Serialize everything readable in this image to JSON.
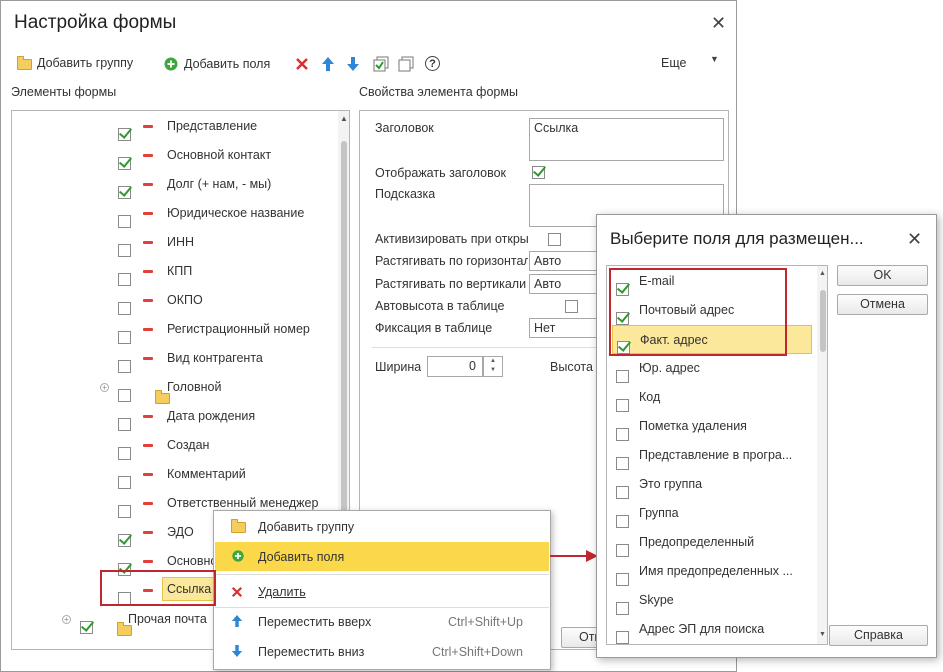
{
  "main_dialog": {
    "title": "Настройка формы",
    "toolbar": {
      "add_group": "Добавить группу",
      "add_fields": "Добавить поля",
      "more": "Еще",
      "help": "?"
    },
    "left_panel_title": "Элементы формы",
    "right_panel_title": "Свойства элемента формы",
    "tree_items": [
      {
        "label": "Представление",
        "checked": true
      },
      {
        "label": "Основной контакт",
        "checked": true
      },
      {
        "label": "Долг (+ нам, - мы)",
        "checked": true
      },
      {
        "label": "Юридическое название",
        "checked": false
      },
      {
        "label": "ИНН",
        "checked": false
      },
      {
        "label": "КПП",
        "checked": false
      },
      {
        "label": "ОКПО",
        "checked": false
      },
      {
        "label": "Регистрационный номер",
        "checked": false
      },
      {
        "label": "Вид контрагента",
        "checked": false
      },
      {
        "label": "Головной",
        "checked": false,
        "folder": true
      },
      {
        "label": "Дата рождения",
        "checked": false
      },
      {
        "label": "Создан",
        "checked": false
      },
      {
        "label": "Комментарий",
        "checked": false
      },
      {
        "label": "Ответственный менеджер",
        "checked": false
      },
      {
        "label": "ЭДО",
        "checked": true
      },
      {
        "label": "Основной",
        "checked": true
      },
      {
        "label": "Ссылка",
        "checked": false,
        "selected": true
      }
    ],
    "tree_partial_item": "Прочая почта",
    "properties": {
      "header_label": "Заголовок",
      "header_value": "Ссылка",
      "show_header_label": "Отображать заголовок",
      "hint_label": "Подсказка",
      "activate_label": "Активизировать при открытии",
      "stretch_h_label": "Растягивать по горизонтали",
      "stretch_h_value": "Авто",
      "stretch_v_label": "Растягивать по вертикали",
      "stretch_v_value": "Авто",
      "autoheight_label": "Автовысота в таблице",
      "fix_label": "Фиксация в таблице",
      "fix_value": "Нет",
      "width_label": "Ширина",
      "width_value": "0",
      "height_label": "Высота"
    },
    "bottom_button_partial": "Отм"
  },
  "context_menu": {
    "items": [
      {
        "label": "Добавить группу",
        "shortcut": ""
      },
      {
        "label": "Добавить поля",
        "shortcut": "",
        "highlighted": true
      },
      {
        "label": "Удалить",
        "shortcut": ""
      },
      {
        "label": "Переместить вверх",
        "shortcut": "Ctrl+Shift+Up"
      },
      {
        "label": "Переместить вниз",
        "shortcut": "Ctrl+Shift+Down"
      }
    ]
  },
  "picker_dialog": {
    "title": "Выберите поля для размещен...",
    "ok": "OK",
    "cancel": "Отмена",
    "help": "Справка",
    "fields": [
      {
        "label": "E-mail",
        "checked": true
      },
      {
        "label": "Почтовый адрес",
        "checked": true
      },
      {
        "label": "Факт. адрес",
        "checked": true,
        "highlighted": true
      },
      {
        "label": "Юр. адрес",
        "checked": false
      },
      {
        "label": "Код",
        "checked": false
      },
      {
        "label": "Пометка удаления",
        "checked": false
      },
      {
        "label": "Представление в програ...",
        "checked": false
      },
      {
        "label": "Это группа",
        "checked": false
      },
      {
        "label": "Группа",
        "checked": false
      },
      {
        "label": "Предопределенный",
        "checked": false
      },
      {
        "label": "Имя предопределенных ...",
        "checked": false
      },
      {
        "label": "Skype",
        "checked": false
      },
      {
        "label": "Адрес ЭП для поиска",
        "checked": false
      }
    ]
  },
  "colors": {
    "highlight": "#fbd84a",
    "annotation_red": "#c0262d",
    "check_green": "#2e9a2e"
  }
}
